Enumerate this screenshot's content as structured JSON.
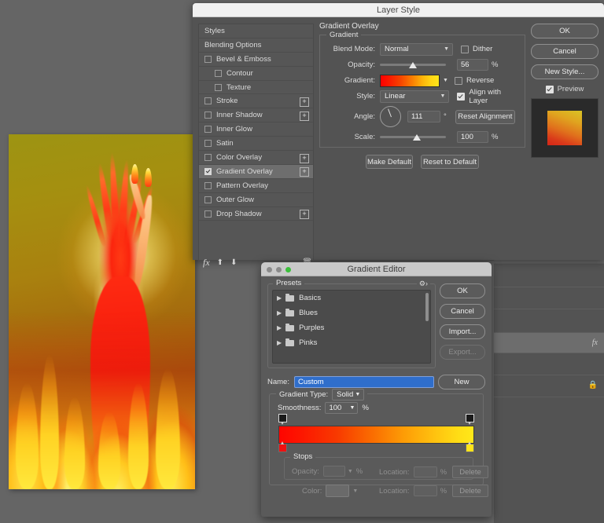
{
  "app": {
    "background_color": "#656565"
  },
  "layer_style": {
    "title": "Layer Style",
    "styles_list": [
      {
        "label": "Styles",
        "checkbox": null,
        "selected": false,
        "indent": false,
        "plus": false
      },
      {
        "label": "Blending Options",
        "checkbox": null,
        "selected": false,
        "indent": false,
        "plus": false
      },
      {
        "label": "Bevel & Emboss",
        "checkbox": false,
        "selected": false,
        "indent": false,
        "plus": false
      },
      {
        "label": "Contour",
        "checkbox": false,
        "selected": false,
        "indent": true,
        "plus": false
      },
      {
        "label": "Texture",
        "checkbox": false,
        "selected": false,
        "indent": true,
        "plus": false
      },
      {
        "label": "Stroke",
        "checkbox": false,
        "selected": false,
        "indent": false,
        "plus": true
      },
      {
        "label": "Inner Shadow",
        "checkbox": false,
        "selected": false,
        "indent": false,
        "plus": true
      },
      {
        "label": "Inner Glow",
        "checkbox": false,
        "selected": false,
        "indent": false,
        "plus": false
      },
      {
        "label": "Satin",
        "checkbox": false,
        "selected": false,
        "indent": false,
        "plus": false
      },
      {
        "label": "Color Overlay",
        "checkbox": false,
        "selected": false,
        "indent": false,
        "plus": true
      },
      {
        "label": "Gradient Overlay",
        "checkbox": true,
        "selected": true,
        "indent": false,
        "plus": true
      },
      {
        "label": "Pattern Overlay",
        "checkbox": false,
        "selected": false,
        "indent": false,
        "plus": false
      },
      {
        "label": "Outer Glow",
        "checkbox": false,
        "selected": false,
        "indent": false,
        "plus": false
      },
      {
        "label": "Drop Shadow",
        "checkbox": false,
        "selected": false,
        "indent": false,
        "plus": true
      }
    ],
    "footer_icons": [
      "fx-icon",
      "move-up-icon",
      "move-down-icon",
      "trash-icon"
    ],
    "section_title": "Gradient Overlay",
    "group_label": "Gradient",
    "fields": {
      "blend_mode_label": "Blend Mode:",
      "blend_mode_value": "Normal",
      "dither_label": "Dither",
      "dither_checked": false,
      "opacity_label": "Opacity:",
      "opacity_value": "56",
      "opacity_unit": "%",
      "gradient_label": "Gradient:",
      "reverse_label": "Reverse",
      "reverse_checked": false,
      "style_label": "Style:",
      "style_value": "Linear",
      "align_label": "Align with Layer",
      "align_checked": true,
      "angle_label": "Angle:",
      "angle_value": "111",
      "angle_unit": "°",
      "reset_alignment_label": "Reset Alignment",
      "scale_label": "Scale:",
      "scale_value": "100",
      "scale_unit": "%"
    },
    "make_default_label": "Make Default",
    "reset_default_label": "Reset to Default",
    "buttons": {
      "ok": "OK",
      "cancel": "Cancel",
      "new_style": "New Style...",
      "preview_label": "Preview",
      "preview_checked": true
    },
    "gradient_colors": [
      "#ff0000",
      "#ffe619"
    ],
    "preview_swatch_colors": [
      "#d8c426",
      "#d52417"
    ]
  },
  "gradient_editor": {
    "title": "Gradient Editor",
    "traffic_lights": [
      "close-button",
      "minimize-button",
      "maximize-button"
    ],
    "presets_label": "Presets",
    "presets_gear": "gear-icon",
    "presets": [
      {
        "label": "Basics"
      },
      {
        "label": "Blues"
      },
      {
        "label": "Purples"
      },
      {
        "label": "Pinks"
      }
    ],
    "buttons": {
      "ok": "OK",
      "cancel": "Cancel",
      "import": "Import...",
      "export": "Export...",
      "export_disabled": true,
      "new": "New"
    },
    "name_label": "Name:",
    "name_value": "Custom",
    "gradient_type_label": "Gradient Type:",
    "gradient_type_value": "Solid",
    "smoothness_label": "Smoothness:",
    "smoothness_value": "100",
    "smoothness_unit": "%",
    "gradient_bar_colors": [
      "#ff0500",
      "#fa6d01",
      "#ffe819"
    ],
    "opacity_stops": [
      {
        "location_pct": 0,
        "color": "#1b1b1b"
      },
      {
        "location_pct": 100,
        "color": "#1b1b1b"
      }
    ],
    "color_stops": [
      {
        "location_pct": 0,
        "color": "#ee1111"
      },
      {
        "location_pct": 100,
        "color": "#ffe41a"
      }
    ],
    "stops_group_label": "Stops",
    "stops": {
      "opacity_label": "Opacity:",
      "opacity_value": "",
      "opacity_unit": "%",
      "opacity_location_label": "Location:",
      "opacity_location_value": "",
      "opacity_location_unit": "%",
      "opacity_delete": "Delete",
      "color_label": "Color:",
      "color_location_label": "Location:",
      "color_location_value": "",
      "color_location_unit": "%",
      "color_delete": "Delete"
    }
  },
  "artwork": {
    "description": "fire-figure-illustration"
  },
  "layers_panel": {
    "rows": [
      {
        "selected": false,
        "badge": null
      },
      {
        "selected": false,
        "badge": null
      },
      {
        "selected": false,
        "badge": null
      },
      {
        "selected": true,
        "badge": "fx"
      },
      {
        "selected": false,
        "badge": null
      },
      {
        "selected": false,
        "badge": "lock-icon"
      }
    ]
  }
}
